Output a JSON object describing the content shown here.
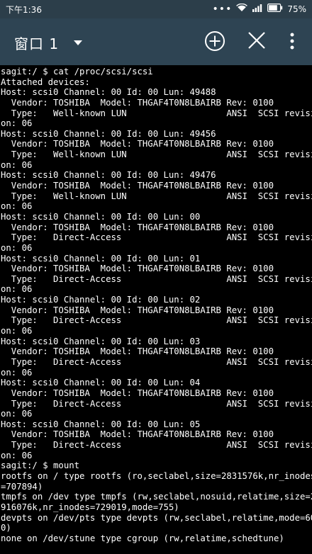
{
  "status_bar": {
    "time": "下午1:36",
    "dots": "•••",
    "battery": "75%"
  },
  "app_bar": {
    "title": "窗口 1"
  },
  "terminal": {
    "lines": [
      "sagit:/ $ cat /proc/scsi/scsi",
      "Attached devices:",
      "Host: scsi0 Channel: 00 Id: 00 Lun: 49488",
      "  Vendor: TOSHIBA  Model: THGAF4T0N8LBAIRB Rev: 0100",
      "  Type:   Well-known LUN                   ANSI  SCSI revisi",
      "on: 06",
      "Host: scsi0 Channel: 00 Id: 00 Lun: 49456",
      "  Vendor: TOSHIBA  Model: THGAF4T0N8LBAIRB Rev: 0100",
      "  Type:   Well-known LUN                   ANSI  SCSI revisi",
      "on: 06",
      "Host: scsi0 Channel: 00 Id: 00 Lun: 49476",
      "  Vendor: TOSHIBA  Model: THGAF4T0N8LBAIRB Rev: 0100",
      "  Type:   Well-known LUN                   ANSI  SCSI revisi",
      "on: 06",
      "Host: scsi0 Channel: 00 Id: 00 Lun: 00",
      "  Vendor: TOSHIBA  Model: THGAF4T0N8LBAIRB Rev: 0100",
      "  Type:   Direct-Access                    ANSI  SCSI revisi",
      "on: 06",
      "Host: scsi0 Channel: 00 Id: 00 Lun: 01",
      "  Vendor: TOSHIBA  Model: THGAF4T0N8LBAIRB Rev: 0100",
      "  Type:   Direct-Access                    ANSI  SCSI revisi",
      "on: 06",
      "Host: scsi0 Channel: 00 Id: 00 Lun: 02",
      "  Vendor: TOSHIBA  Model: THGAF4T0N8LBAIRB Rev: 0100",
      "  Type:   Direct-Access                    ANSI  SCSI revisi",
      "on: 06",
      "Host: scsi0 Channel: 00 Id: 00 Lun: 03",
      "  Vendor: TOSHIBA  Model: THGAF4T0N8LBAIRB Rev: 0100",
      "  Type:   Direct-Access                    ANSI  SCSI revisi",
      "on: 06",
      "Host: scsi0 Channel: 00 Id: 00 Lun: 04",
      "  Vendor: TOSHIBA  Model: THGAF4T0N8LBAIRB Rev: 0100",
      "  Type:   Direct-Access                    ANSI  SCSI revisi",
      "on: 06",
      "Host: scsi0 Channel: 00 Id: 00 Lun: 05",
      "  Vendor: TOSHIBA  Model: THGAF4T0N8LBAIRB Rev: 0100",
      "  Type:   Direct-Access                    ANSI  SCSI revisi",
      "on: 06",
      "sagit:/ $ mount",
      "rootfs on / type rootfs (ro,seclabel,size=2831576k,nr_inodes",
      "=707894)",
      "tmpfs on /dev type tmpfs (rw,seclabel,nosuid,relatime,size=2",
      "916076k,nr_inodes=729019,mode=755)",
      "devpts on /dev/pts type devpts (rw,seclabel,relatime,mode=60",
      "0)",
      "none on /dev/stune type cgroup (rw,relatime,schedtune)"
    ]
  },
  "colors": {
    "status_bar": "#2c3e4a",
    "app_bar": "#2e4453",
    "terminal_bg": "#000000",
    "terminal_fg": "#ffffff"
  },
  "icons": {
    "status": [
      "wifi-icon",
      "signal-icon",
      "battery-icon"
    ],
    "app_bar": [
      "dropdown-icon",
      "add-icon",
      "close-icon",
      "overflow-menu-icon"
    ]
  }
}
